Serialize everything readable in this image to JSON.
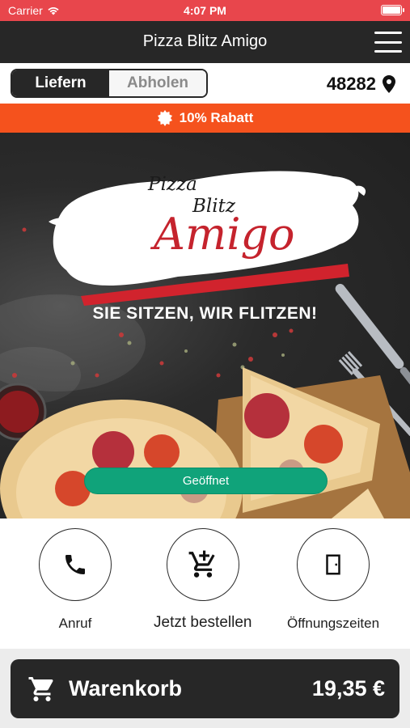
{
  "status_bar": {
    "carrier": "Carrier",
    "time": "4:07 PM"
  },
  "header": {
    "title": "Pizza Blitz Amigo"
  },
  "mode": {
    "deliver_label": "Liefern",
    "pickup_label": "Abholen",
    "active": "Liefern",
    "zip": "48282"
  },
  "promo": {
    "text": "10% Rabatt"
  },
  "hero": {
    "logo_line1": "Pizza",
    "logo_line2": "Blitz",
    "logo_line3": "Amigo",
    "slogan": "SIE SITZEN, WIR FLITZEN!",
    "open_status": "Geöffnet"
  },
  "actions": [
    {
      "label": "Anruf",
      "icon": "phone-icon"
    },
    {
      "label": "Jetzt bestellen",
      "icon": "cart-icon"
    },
    {
      "label": "Öffnungszeiten",
      "icon": "door-icon"
    }
  ],
  "cart": {
    "label": "Warenkorb",
    "total": "19,35 €"
  },
  "colors": {
    "status_bar": "#e8464c",
    "header": "#272727",
    "promo": "#f5521d",
    "open_badge": "#10a37a",
    "logo_red": "#c5232d"
  }
}
